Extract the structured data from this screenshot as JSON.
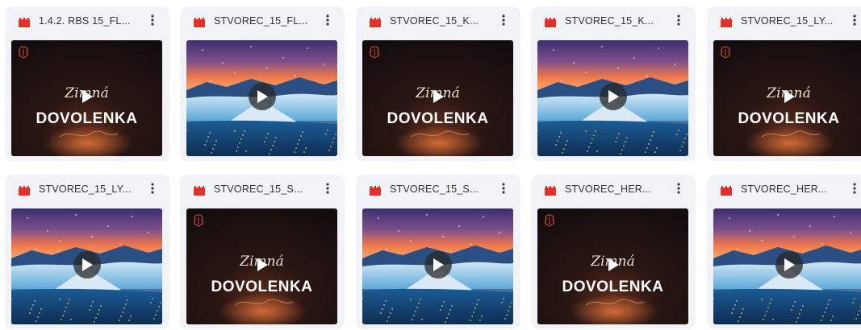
{
  "icons": {
    "file": "video-file-icon",
    "more": "more-vert-icon",
    "play": "play-icon",
    "logo": "brand-logo-icon"
  },
  "colors": {
    "card_bg": "#f1f3f6",
    "file_icon": "#e4302b",
    "title_text": "#303236"
  },
  "overlay": {
    "script_word": "Zimná",
    "main_word": "DOVOLENKA"
  },
  "files": [
    {
      "title": "1.4.2. RBS 15_FL...",
      "thumb": "dark"
    },
    {
      "title": "STVOREC_15_FL...",
      "thumb": "landscape"
    },
    {
      "title": "STVOREC_15_K...",
      "thumb": "dark"
    },
    {
      "title": "STVOREC_15_K...",
      "thumb": "landscape"
    },
    {
      "title": "STVOREC_15_LY...",
      "thumb": "dark"
    },
    {
      "title": "STVOREC_15_LY...",
      "thumb": "landscape"
    },
    {
      "title": "STVOREC_15_S...",
      "thumb": "dark"
    },
    {
      "title": "STVOREC_15_S...",
      "thumb": "landscape"
    },
    {
      "title": "STVOREC_HER...",
      "thumb": "dark"
    },
    {
      "title": "STVOREC_HER...",
      "thumb": "landscape"
    }
  ]
}
